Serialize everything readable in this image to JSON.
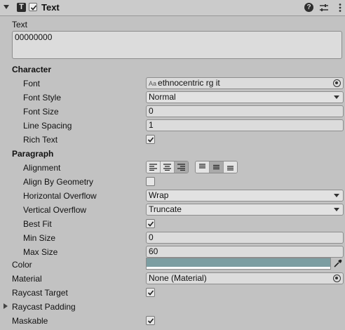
{
  "header": {
    "title": "Text",
    "icons": [
      "fold-arrow-icon",
      "text-component-icon",
      "help-icon",
      "presets-icon",
      "kebab-menu-icon"
    ],
    "enabled": true
  },
  "text_label": "Text",
  "text_value": "00000000",
  "character": {
    "heading": "Character",
    "font_label": "Font",
    "font_value": "ethnocentric rg it",
    "font_icon": "Aa",
    "font_style_label": "Font Style",
    "font_style_value": "Normal",
    "font_size_label": "Font Size",
    "font_size_value": "0",
    "line_spacing_label": "Line Spacing",
    "line_spacing_value": "1",
    "rich_text_label": "Rich Text",
    "rich_text_checked": true
  },
  "paragraph": {
    "heading": "Paragraph",
    "alignment_label": "Alignment",
    "horizontal_alignment_selected": "right",
    "vertical_alignment_selected": "middle",
    "align_by_geometry_label": "Align By Geometry",
    "align_by_geometry_checked": false,
    "horizontal_overflow_label": "Horizontal Overflow",
    "horizontal_overflow_value": "Wrap",
    "vertical_overflow_label": "Vertical Overflow",
    "vertical_overflow_value": "Truncate",
    "best_fit_label": "Best Fit",
    "best_fit_checked": true,
    "min_size_label": "Min Size",
    "min_size_value": "0",
    "max_size_label": "Max Size",
    "max_size_value": "60"
  },
  "color_label": "Color",
  "color_value": "#7c9ea2",
  "material_label": "Material",
  "material_value": "None (Material)",
  "raycast_target_label": "Raycast Target",
  "raycast_target_checked": true,
  "raycast_padding_label": "Raycast Padding",
  "maskable_label": "Maskable",
  "maskable_checked": true
}
